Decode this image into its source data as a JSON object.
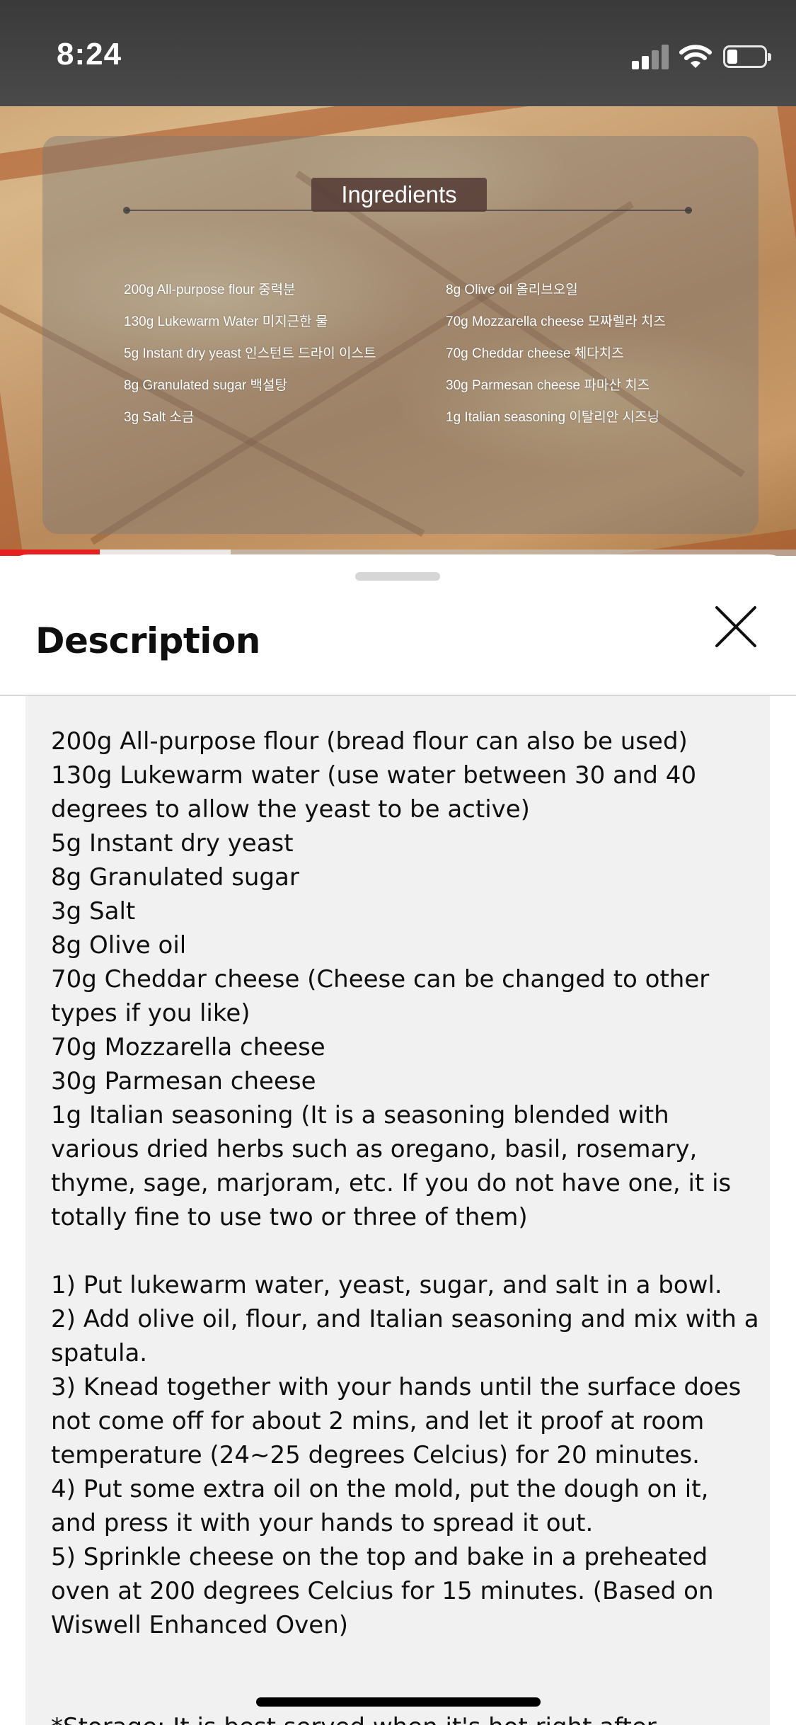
{
  "status_bar": {
    "time": "8:24"
  },
  "video": {
    "overlay_title": "Ingredients",
    "ingredients_left": [
      "200g All-purpose flour 중력분",
      "130g Lukewarm Water 미지근한 물",
      "5g Instant dry yeast 인스턴트 드라이 이스트",
      "8g Granulated sugar 백설탕",
      "3g Salt 소금"
    ],
    "ingredients_right": [
      "8g Olive oil 올리브오일",
      "70g Mozzarella cheese 모짜렐라 치즈",
      "70g Cheddar cheese 체다치즈",
      "30g Parmesan cheese 파마산 치즈",
      "1g Italian seasoning 이탈리안 시즈닝"
    ],
    "progress_fraction": 0.125,
    "buffer_fraction": 0.29,
    "progress_color": "#e5201e"
  },
  "sheet": {
    "title": "Description",
    "close_icon": "close-icon",
    "lines": [
      "200g All-purpose flour (bread flour can also be used)",
      "130g Lukewarm water (use water between 30 and 40",
      "degrees to allow the yeast to be active)",
      "5g Instant dry yeast",
      "8g Granulated sugar",
      "3g Salt",
      "8g Olive oil",
      "70g Cheddar cheese (Cheese can be changed to other",
      "types if you like)",
      "70g Mozzarella cheese",
      "30g Parmesan cheese",
      "1g Italian seasoning (It is a seasoning blended with",
      "various dried herbs such as oregano, basil, rosemary,",
      "thyme, sage, marjoram, etc. If you do not have one, it is",
      "totally fine to use two or three of them)",
      "",
      "1) Put lukewarm water, yeast, sugar, and salt in a bowl.",
      "2) Add olive oil, flour, and Italian seasoning and mix with a",
      "spatula.",
      "3) Knead together with your hands until the surface does",
      "not come off for about 2 mins, and let it proof at room",
      "temperature (24~25 degrees Celcius) for 20 minutes.",
      "4) Put some extra oil on the mold, put the dough on it,",
      "and press it with your hands to spread it out.",
      "5) Sprinkle cheese on the top and bake in a preheated",
      "oven at 200 degrees Celcius for 15 minutes. (Based on",
      "Wiswell Enhanced Oven)",
      "",
      "",
      "*Storage: It is best served when it's hot right after"
    ]
  }
}
